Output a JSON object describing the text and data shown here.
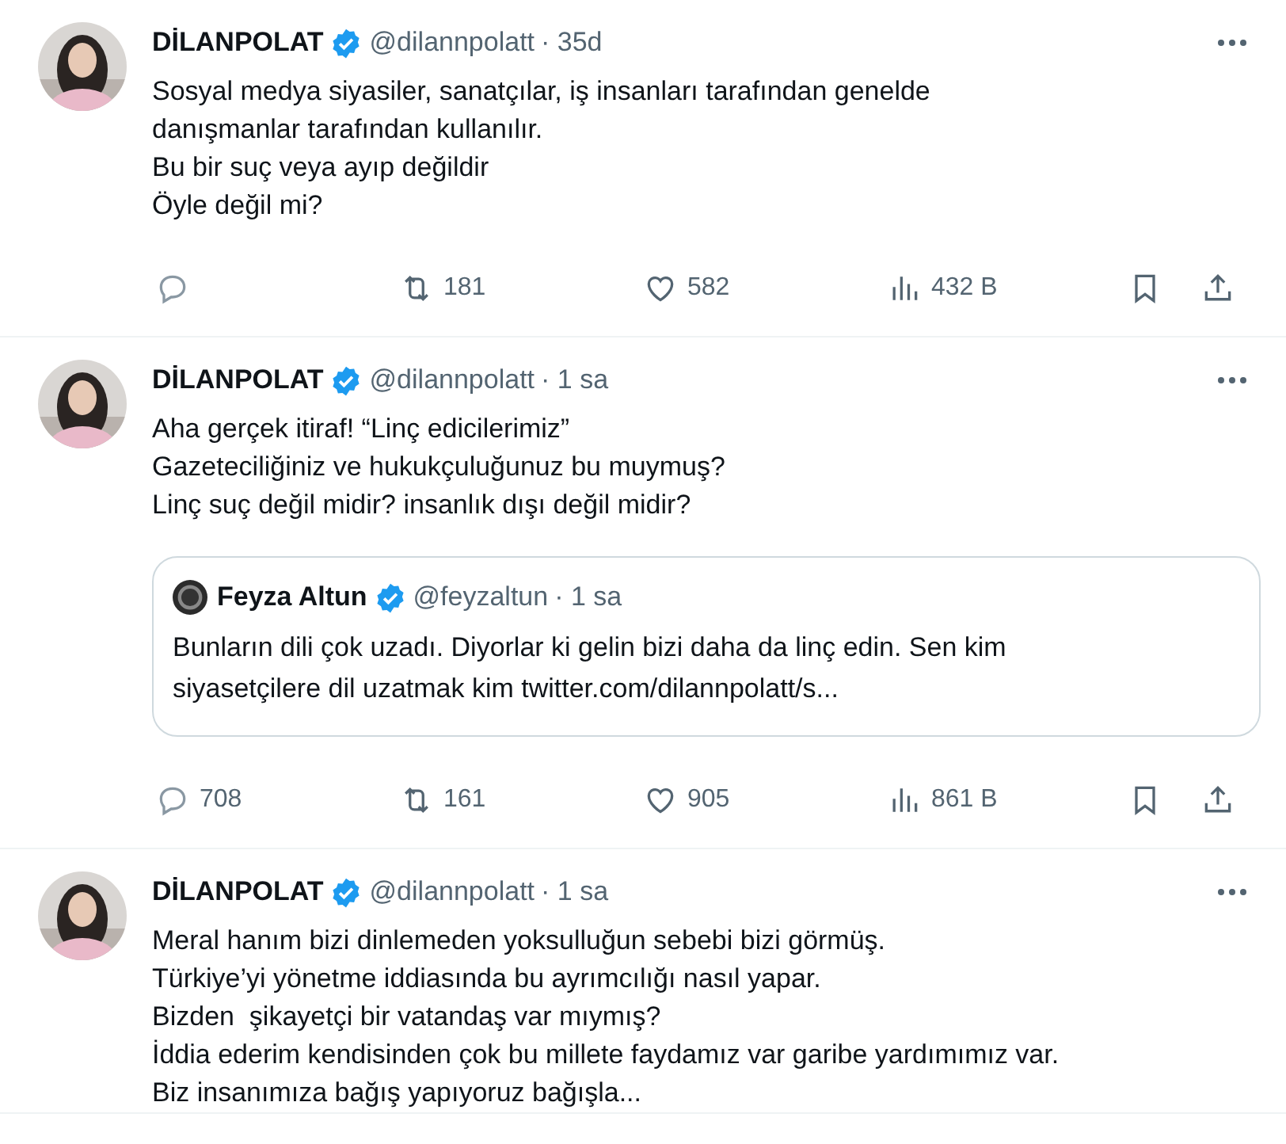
{
  "tweets": [
    {
      "name": "DİLANPOLAT",
      "verified": true,
      "handle": "@dilannpolatt",
      "time": "· 35d",
      "lines": [
        "Sosyal medya siyasiler, sanatçılar, iş insanları tarafından genelde",
        "danışmanlar tarafından kullanılır.",
        "Bu bir suç veya ayıp değildir",
        "Öyle değil mi?"
      ],
      "actions": {
        "retweets": "181",
        "likes": "582",
        "views": "432 B"
      }
    },
    {
      "name": "DİLANPOLAT",
      "verified": true,
      "handle": "@dilannpolatt",
      "time": "· 1 sa",
      "lines": [
        "Aha gerçek itiraf! “Linç edicilerimiz”",
        "Gazeteciliğiniz ve hukukçuluğunuz bu muymuş?",
        "Linç suç değil midir? insanlık dışı değil midir?"
      ],
      "quote": {
        "name": "Feyza Altun",
        "verified": true,
        "handle": "@feyzaltun",
        "time": "· 1 sa",
        "lines": [
          "Bunların dili çok uzadı. Diyorlar ki gelin bizi daha da linç edin. Sen kim",
          "siyasetçilere dil uzatmak kim twitter.com/dilannpolatt/s..."
        ]
      },
      "actions": {
        "replies": "708",
        "retweets": "161",
        "likes": "905",
        "views": "861 B"
      }
    },
    {
      "name": "DİLANPOLAT",
      "verified": true,
      "handle": "@dilannpolatt",
      "time": "· 1 sa",
      "lines": [
        "Meral hanım bizi dinlemeden yoksulluğun sebebi bizi görmüş.",
        "Türkiye’yi yönetme iddiasında bu ayrımcılığı nasıl yapar.",
        "Bizden  şikayetçi bir vatandaş var mıymış?",
        "İddia ederim kendisinden çok bu millete faydamız var garibe yardımımız var.",
        "Biz insanımıza bağış yapıyoruz bağışla..."
      ]
    }
  ]
}
